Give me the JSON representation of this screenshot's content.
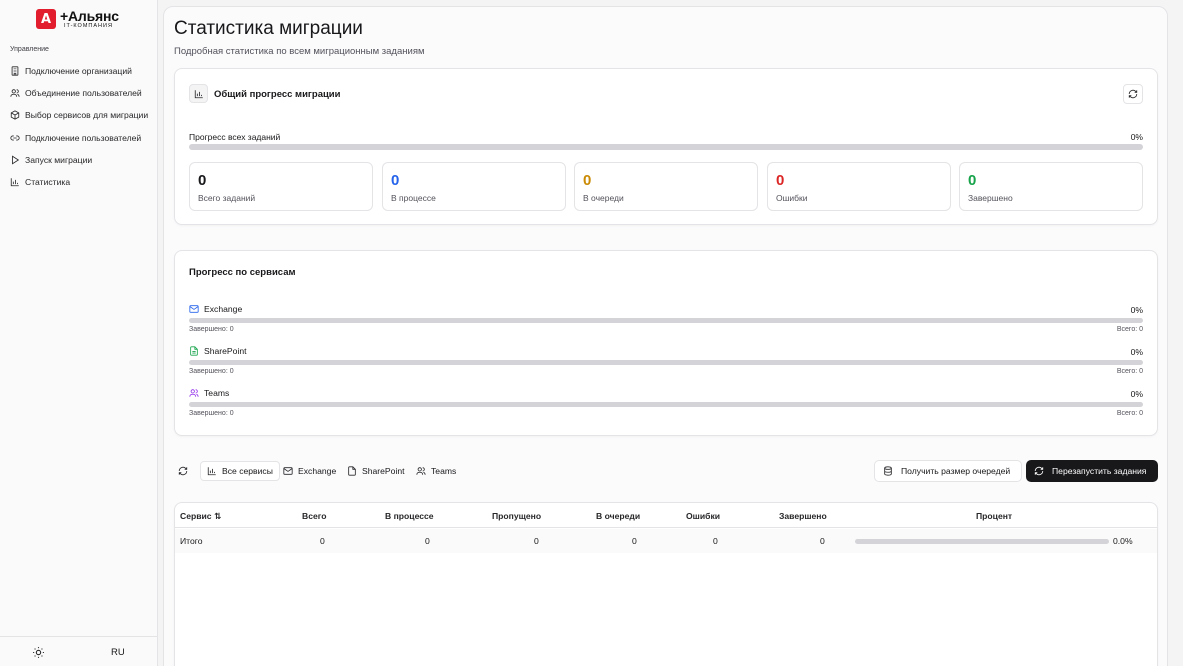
{
  "brand": {
    "name": "+Альянс",
    "subtitle": "IT-КОМПАНИЯ"
  },
  "sidebar": {
    "section": "Управление",
    "items": [
      {
        "label": "Подключение организаций",
        "icon": "building-icon"
      },
      {
        "label": "Объединение пользователей",
        "icon": "users-icon"
      },
      {
        "label": "Выбор сервисов для миграции",
        "icon": "box-icon"
      },
      {
        "label": "Подключение пользователей",
        "icon": "link-icon"
      },
      {
        "label": "Запуск миграции",
        "icon": "play-icon"
      },
      {
        "label": "Статистика",
        "icon": "bar-chart-icon"
      }
    ],
    "footer": {
      "theme_icon": "sun-icon",
      "language": "RU"
    }
  },
  "page": {
    "title": "Статистика миграции",
    "subtitle": "Подробная статистика по всем миграционным заданиям"
  },
  "overall": {
    "title": "Общий прогресс миграции",
    "progress_label": "Прогресс всех заданий",
    "progress_text": "0%",
    "progress_value": 0,
    "stats": [
      {
        "value": "0",
        "label": "Всего заданий",
        "color": "#18181b"
      },
      {
        "value": "0",
        "label": "В процессе",
        "color": "#2563eb"
      },
      {
        "value": "0",
        "label": "В очереди",
        "color": "#ca8a04"
      },
      {
        "value": "0",
        "label": "Ошибки",
        "color": "#dc2626"
      },
      {
        "value": "0",
        "label": "Завершено",
        "color": "#16a34a"
      }
    ]
  },
  "services": {
    "title": "Прогресс по сервисам",
    "items": [
      {
        "name": "Exchange",
        "icon": "mail-icon",
        "icon_color": "#2563eb",
        "percent": "0%",
        "done": "Завершено: 0",
        "total": "Всего: 0"
      },
      {
        "name": "SharePoint",
        "icon": "file-icon",
        "icon_color": "#16a34a",
        "percent": "0%",
        "done": "Завершено: 0",
        "total": "Всего: 0"
      },
      {
        "name": "Teams",
        "icon": "users-icon",
        "icon_color": "#9333ea",
        "percent": "0%",
        "done": "Завершено: 0",
        "total": "Всего: 0"
      }
    ]
  },
  "toolbar": {
    "tabs": [
      {
        "label": "Все сервисы",
        "icon": "bar-chart-icon",
        "active": true
      },
      {
        "label": "Exchange",
        "icon": "mail-icon",
        "active": false
      },
      {
        "label": "SharePoint",
        "icon": "file-icon",
        "active": false
      },
      {
        "label": "Teams",
        "icon": "users-icon",
        "active": false
      }
    ],
    "queue_size_button": "Получить размер очередей",
    "restart_button": "Перезапустить задания"
  },
  "table": {
    "columns": [
      "Сервис ⇅",
      "Всего",
      "В процессе",
      "Пропущено",
      "В очереди",
      "Ошибки",
      "Завершено",
      "Процент"
    ],
    "rows": [
      {
        "service": "Итого",
        "total": "0",
        "in_progress": "0",
        "skipped": "0",
        "queued": "0",
        "errors": "0",
        "completed": "0",
        "percent": "0.0%",
        "progress_value": 0
      }
    ]
  }
}
